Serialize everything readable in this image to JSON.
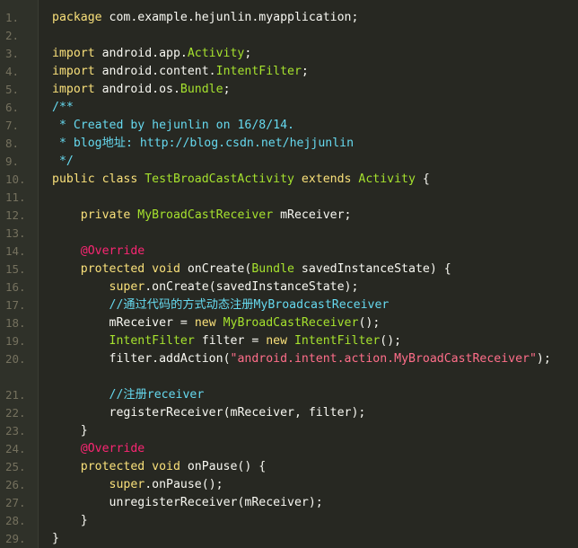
{
  "editor": {
    "colors": {
      "background": "#272822",
      "gutter": "#2f3129",
      "line_number": "#75715e",
      "plain": "#f8f8f2",
      "keyword": "#f9e07a",
      "type": "#a6e22e",
      "string": "#ff6e8a",
      "comment": "#66d9ef",
      "annotation": "#f92672"
    },
    "lines": [
      {
        "n": "1.",
        "tokens": [
          {
            "t": "keyword",
            "s": "package "
          },
          {
            "t": "plain",
            "s": "com.example.hejunlin.myapplication;"
          }
        ]
      },
      {
        "n": "2.",
        "tokens": []
      },
      {
        "n": "3.",
        "tokens": [
          {
            "t": "keyword",
            "s": "import "
          },
          {
            "t": "plain",
            "s": "android.app."
          },
          {
            "t": "type",
            "s": "Activity"
          },
          {
            "t": "plain",
            "s": ";"
          }
        ]
      },
      {
        "n": "4.",
        "tokens": [
          {
            "t": "keyword",
            "s": "import "
          },
          {
            "t": "plain",
            "s": "android.content."
          },
          {
            "t": "type",
            "s": "IntentFilter"
          },
          {
            "t": "plain",
            "s": ";"
          }
        ]
      },
      {
        "n": "5.",
        "tokens": [
          {
            "t": "keyword",
            "s": "import "
          },
          {
            "t": "plain",
            "s": "android.os."
          },
          {
            "t": "type",
            "s": "Bundle"
          },
          {
            "t": "plain",
            "s": ";"
          }
        ]
      },
      {
        "n": "6.",
        "tokens": [
          {
            "t": "comment",
            "s": "/**"
          }
        ]
      },
      {
        "n": "7.",
        "tokens": [
          {
            "t": "comment",
            "s": " * Created by hejunlin on 16/8/14."
          }
        ]
      },
      {
        "n": "8.",
        "tokens": [
          {
            "t": "comment",
            "s": " * blog地址: http://blog.csdn.net/hejjunlin"
          }
        ]
      },
      {
        "n": "9.",
        "tokens": [
          {
            "t": "comment",
            "s": " */"
          }
        ]
      },
      {
        "n": "10.",
        "tokens": [
          {
            "t": "keyword",
            "s": "public class "
          },
          {
            "t": "type",
            "s": "TestBroadCastActivity "
          },
          {
            "t": "keyword",
            "s": "extends "
          },
          {
            "t": "type",
            "s": "Activity "
          },
          {
            "t": "plain",
            "s": "{"
          }
        ]
      },
      {
        "n": "11.",
        "tokens": []
      },
      {
        "n": "12.",
        "tokens": [
          {
            "t": "plain",
            "s": "    "
          },
          {
            "t": "keyword",
            "s": "private "
          },
          {
            "t": "type",
            "s": "MyBroadCastReceiver "
          },
          {
            "t": "plain",
            "s": "mReceiver;"
          }
        ]
      },
      {
        "n": "13.",
        "tokens": []
      },
      {
        "n": "14.",
        "tokens": [
          {
            "t": "plain",
            "s": "    "
          },
          {
            "t": "annot",
            "s": "@Override"
          }
        ]
      },
      {
        "n": "15.",
        "tokens": [
          {
            "t": "plain",
            "s": "    "
          },
          {
            "t": "keyword",
            "s": "protected void "
          },
          {
            "t": "plain",
            "s": "onCreate("
          },
          {
            "t": "type",
            "s": "Bundle "
          },
          {
            "t": "plain",
            "s": "savedInstanceState) {"
          }
        ]
      },
      {
        "n": "16.",
        "tokens": [
          {
            "t": "plain",
            "s": "        "
          },
          {
            "t": "keyword",
            "s": "super"
          },
          {
            "t": "plain",
            "s": ".onCreate(savedInstanceState);"
          }
        ]
      },
      {
        "n": "17.",
        "tokens": [
          {
            "t": "plain",
            "s": "        "
          },
          {
            "t": "comment",
            "s": "//通过代码的方式动态注册MyBroadcastReceiver"
          }
        ]
      },
      {
        "n": "18.",
        "tokens": [
          {
            "t": "plain",
            "s": "        mReceiver = "
          },
          {
            "t": "keyword",
            "s": "new "
          },
          {
            "t": "type",
            "s": "MyBroadCastReceiver"
          },
          {
            "t": "plain",
            "s": "();"
          }
        ]
      },
      {
        "n": "19.",
        "tokens": [
          {
            "t": "plain",
            "s": "        "
          },
          {
            "t": "type",
            "s": "IntentFilter "
          },
          {
            "t": "plain",
            "s": "filter = "
          },
          {
            "t": "keyword",
            "s": "new "
          },
          {
            "t": "type",
            "s": "IntentFilter"
          },
          {
            "t": "plain",
            "s": "();"
          }
        ]
      },
      {
        "n": "20.",
        "tall": true,
        "tokens": [
          {
            "t": "plain",
            "s": "        filter.addAction("
          },
          {
            "t": "string",
            "s": "\"android.intent.action.MyBroadCastReceiver\""
          },
          {
            "t": "plain",
            "s": ");"
          }
        ]
      },
      {
        "n": "21.",
        "tokens": [
          {
            "t": "plain",
            "s": "        "
          },
          {
            "t": "comment",
            "s": "//注册receiver"
          }
        ]
      },
      {
        "n": "22.",
        "tokens": [
          {
            "t": "plain",
            "s": "        registerReceiver(mReceiver, filter);"
          }
        ]
      },
      {
        "n": "23.",
        "tokens": [
          {
            "t": "plain",
            "s": "    }"
          }
        ]
      },
      {
        "n": "24.",
        "tokens": [
          {
            "t": "plain",
            "s": "    "
          },
          {
            "t": "annot",
            "s": "@Override"
          }
        ]
      },
      {
        "n": "25.",
        "tokens": [
          {
            "t": "plain",
            "s": "    "
          },
          {
            "t": "keyword",
            "s": "protected void "
          },
          {
            "t": "plain",
            "s": "onPause() {"
          }
        ]
      },
      {
        "n": "26.",
        "tokens": [
          {
            "t": "plain",
            "s": "        "
          },
          {
            "t": "keyword",
            "s": "super"
          },
          {
            "t": "plain",
            "s": ".onPause();"
          }
        ]
      },
      {
        "n": "27.",
        "tokens": [
          {
            "t": "plain",
            "s": "        unregisterReceiver(mReceiver);"
          }
        ]
      },
      {
        "n": "28.",
        "tokens": [
          {
            "t": "plain",
            "s": "    }"
          }
        ]
      },
      {
        "n": "29.",
        "tokens": [
          {
            "t": "plain",
            "s": "}"
          }
        ]
      }
    ]
  }
}
